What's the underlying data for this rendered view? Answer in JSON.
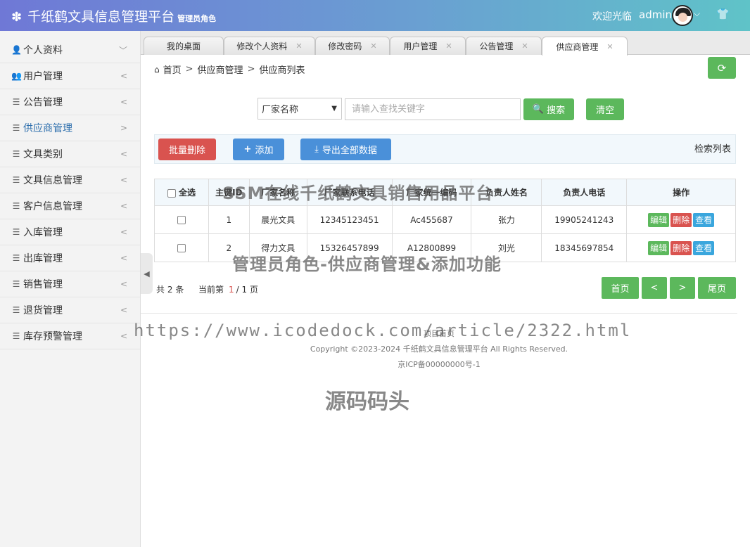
{
  "header": {
    "title": "千纸鹤文具信息管理平台",
    "role": "管理员角色",
    "welcome": "欢迎光临",
    "username": "admin"
  },
  "sidebar": {
    "items": [
      {
        "label": "个人资料",
        "icon": "user-icon",
        "arrow": "﹀"
      },
      {
        "label": "用户管理",
        "icon": "users-icon",
        "arrow": "<"
      },
      {
        "label": "公告管理",
        "icon": "list-icon",
        "arrow": "<"
      },
      {
        "label": "供应商管理",
        "icon": "list-icon",
        "arrow": ">"
      },
      {
        "label": "文具类别",
        "icon": "list-icon",
        "arrow": "<"
      },
      {
        "label": "文具信息管理",
        "icon": "list-icon",
        "arrow": "<"
      },
      {
        "label": "客户信息管理",
        "icon": "list-icon",
        "arrow": "<"
      },
      {
        "label": "入库管理",
        "icon": "list-icon",
        "arrow": "<"
      },
      {
        "label": "出库管理",
        "icon": "list-icon",
        "arrow": "<"
      },
      {
        "label": "销售管理",
        "icon": "list-icon",
        "arrow": "<"
      },
      {
        "label": "退货管理",
        "icon": "list-icon",
        "arrow": "<"
      },
      {
        "label": "库存预警管理",
        "icon": "list-icon",
        "arrow": "<"
      }
    ],
    "active_index": 3
  },
  "tabs": [
    "我的桌面",
    "修改个人资料",
    "修改密码",
    "用户管理",
    "公告管理",
    "供应商管理"
  ],
  "active_tab": "供应商管理",
  "breadcrumb": [
    "首页",
    "供应商管理",
    "供应商列表"
  ],
  "search": {
    "field": "厂家名称",
    "placeholder": "请输入查找关键字",
    "search_label": "搜索",
    "clear_label": "清空"
  },
  "toolbar": {
    "batch_delete": "批量删除",
    "add": "添加",
    "export_all": "导出全部数据",
    "search_list": "检索列表"
  },
  "table": {
    "select_all": "全选",
    "columns": [
      "主键ID",
      "厂家名称",
      "厂家联系电话",
      "厂家统一编码",
      "负责人姓名",
      "负责人电话",
      "操作"
    ],
    "rows": [
      [
        "1",
        "晨光文具",
        "12345123451",
        "Ac455687",
        "张力",
        "19905241243"
      ],
      [
        "2",
        "得力文具",
        "15326457899",
        "A12800899",
        "刘光",
        "18345697854"
      ]
    ],
    "actions": {
      "edit": "编辑",
      "delete": "删除",
      "view": "查看"
    }
  },
  "pager": {
    "total_prefix": "共",
    "total": "2",
    "total_suffix": "条",
    "current_prefix": "当前第",
    "current": "1",
    "pages": "/ 1 页",
    "first": "首页",
    "prev": "<",
    "next": ">",
    "last": "尾页"
  },
  "footer": {
    "home": "项目首页",
    "copyright": "Copyright ©2023-2024 千纸鹤文具信息管理平台 All Rights Reserved.",
    "icp": "京ICP备00000000号-1"
  },
  "watermarks": {
    "platform": "SSM在线千纸鹤文具销售用品平台",
    "feature": "管理员角色-供应商管理&添加功能",
    "url": "https://www.icodedock.com/article/2322.html",
    "source": "源码码头"
  }
}
